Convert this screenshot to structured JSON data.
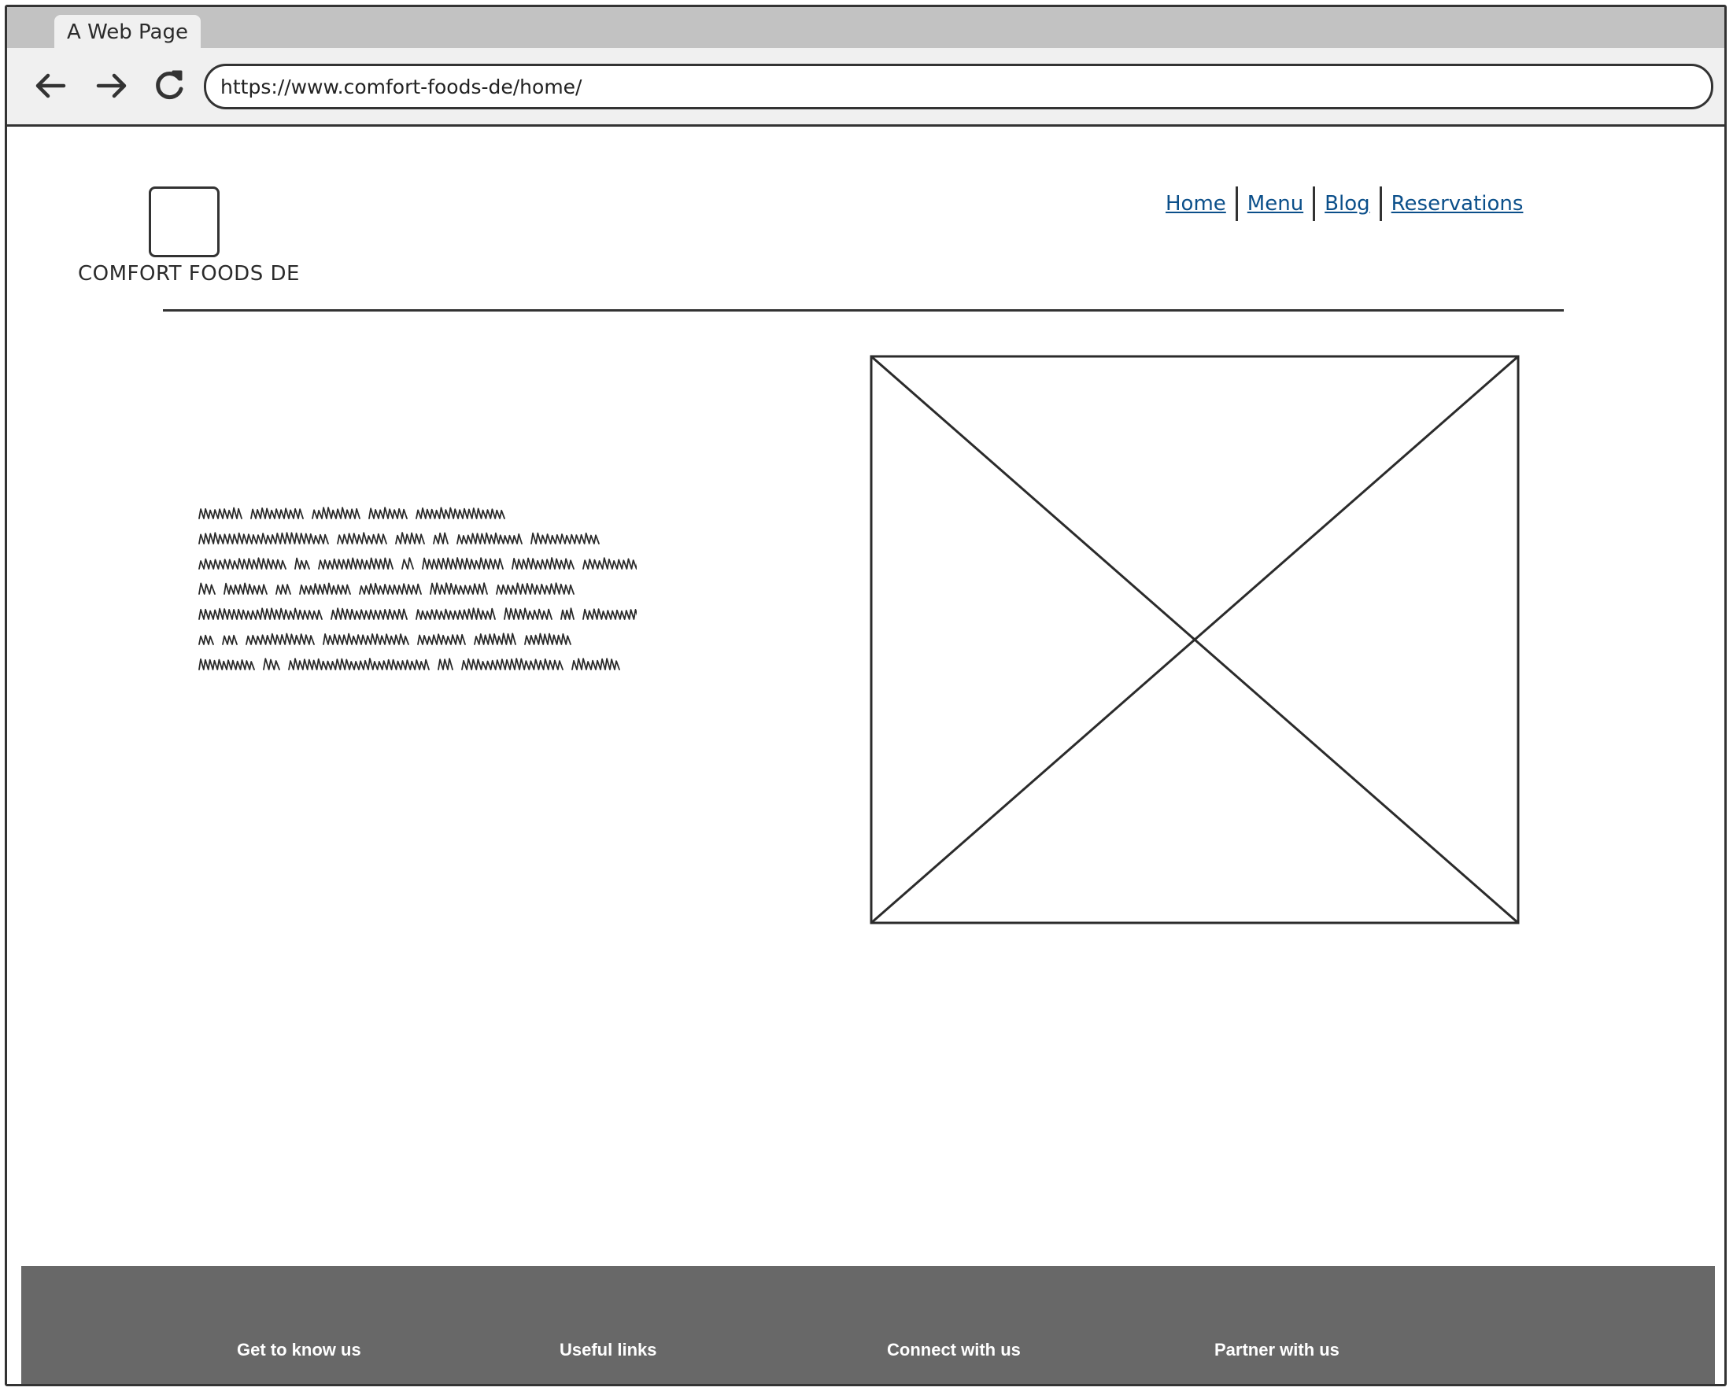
{
  "browser": {
    "tab_title": "A Web Page",
    "url": "https://www.comfort-foods-de/home/",
    "icons": {
      "back": "back-arrow-icon",
      "forward": "forward-arrow-icon",
      "reload": "reload-icon"
    }
  },
  "site": {
    "logo_text": "COMFORT FOODS DE",
    "nav": [
      "Home",
      "Menu",
      "Blog",
      "Reservations"
    ],
    "link_color": "#0b4f8a"
  },
  "footer": {
    "background": "#686868",
    "columns": [
      "Get to know us",
      "Useful links",
      "Connect with us",
      "Partner with us"
    ]
  }
}
